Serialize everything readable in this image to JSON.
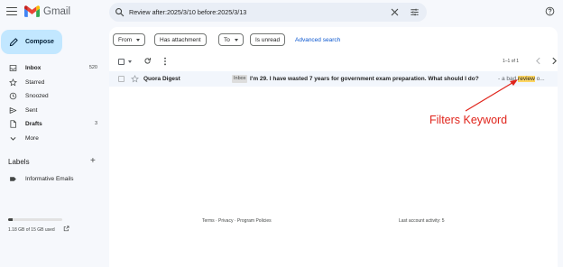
{
  "app": {
    "name": "Gmail"
  },
  "search": {
    "query": "Review after:2025/3/10 before:2025/3/13"
  },
  "sidebar": {
    "compose_label": "Compose",
    "items": [
      {
        "label": "Inbox",
        "count": "520",
        "icon": "inbox-icon"
      },
      {
        "label": "Starred",
        "count": "",
        "icon": "star-icon"
      },
      {
        "label": "Snoozed",
        "count": "",
        "icon": "clock-icon"
      },
      {
        "label": "Sent",
        "count": "",
        "icon": "send-icon"
      },
      {
        "label": "Drafts",
        "count": "3",
        "icon": "draft-icon"
      },
      {
        "label": "More",
        "count": "",
        "icon": "chevron-down-icon"
      }
    ],
    "labels_heading": "Labels",
    "labels": [
      {
        "label": "Informative Emails",
        "icon": "label-icon"
      }
    ]
  },
  "filters": {
    "from": "From",
    "has_attachment": "Has attachment",
    "to": "To",
    "is_unread": "Is unread",
    "advanced": "Advanced search"
  },
  "toolbar": {
    "pager": "1–1 of 1"
  },
  "emails": [
    {
      "sender": "Quora Digest",
      "badge": "Inbox",
      "subject": "I'm 29. I have wasted 7 years for government exam preparation. What should I do?",
      "snippet_before": " - a bad ",
      "snippet_highlight": "review",
      "snippet_after": " o..."
    }
  ],
  "annotation": {
    "text": "Filters Keyword",
    "color": "#e0241b"
  },
  "footer": {
    "storage": "1.18 GB of 15 GB used",
    "storage_fraction": 0.08,
    "links": "Terms · Privacy · Program Policies",
    "activity": "Last account activity: 5"
  },
  "colors": {
    "accent": "#0b57d0",
    "compose_bg": "#c2e7ff",
    "highlight": "#fdd663"
  }
}
